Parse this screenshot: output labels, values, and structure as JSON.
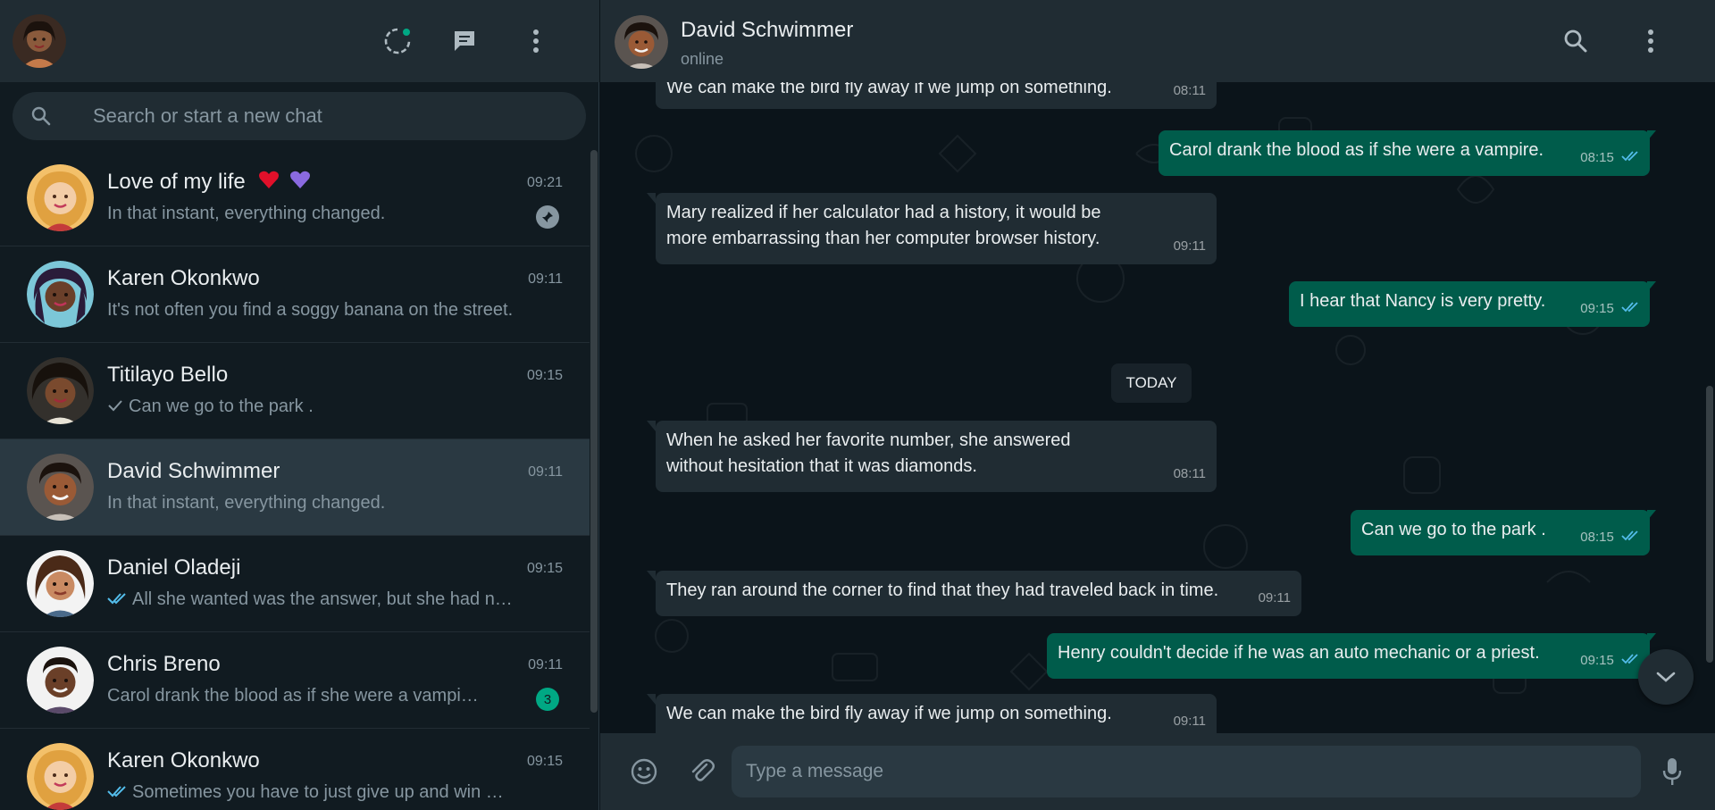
{
  "search": {
    "placeholder": "Search or start a new chat"
  },
  "chats": [
    {
      "name": "Love of my life",
      "time": "09:21",
      "preview": "In that instant, everything changed.",
      "pinned": true,
      "hearts": [
        "red-heart",
        "purple-heart"
      ]
    },
    {
      "name": "Karen Okonkwo",
      "time": "09:11",
      "preview": "It's not often you find a soggy banana on the street."
    },
    {
      "name": "Titilayo Bello",
      "time": "09:15",
      "preview": "Can we go to the park .",
      "tick": "single"
    },
    {
      "name": "David Schwimmer",
      "time": "09:11",
      "preview": "In that instant, everything changed.",
      "active": true
    },
    {
      "name": "Daniel Oladeji",
      "time": "09:15",
      "preview": "All she wanted was the answer, but she had n…",
      "tick": "double-blue"
    },
    {
      "name": "Chris Breno",
      "time": "09:11",
      "preview": "Carol drank the blood as if she were a vampi…",
      "unread": "3"
    },
    {
      "name": "Karen Okonkwo",
      "time": "09:15",
      "preview": "Sometimes you have to just give up and win …",
      "tick": "double-blue"
    }
  ],
  "conversation": {
    "name": "David Schwimmer",
    "status": "online",
    "date_label": "TODAY",
    "messages": [
      {
        "dir": "in",
        "text": "We can make the bird fly away if we jump on something.",
        "time": "08:11"
      },
      {
        "dir": "out",
        "text": "Carol drank the blood as if she were a vampire.",
        "time": "08:15"
      },
      {
        "dir": "in",
        "text": "Mary realized if her calculator had a history, it would be more embarrassing than her computer browser history.",
        "time": "09:11"
      },
      {
        "dir": "out",
        "text": "I hear that Nancy is very pretty.",
        "time": "09:15"
      },
      {
        "dir": "in",
        "text": "When he asked her favorite number, she answered without hesitation that it was diamonds.",
        "time": "08:11"
      },
      {
        "dir": "out",
        "text": "Can we go to the park .",
        "time": "08:15"
      },
      {
        "dir": "in",
        "text": "They ran around the corner to find that they had traveled back in time.",
        "time": "09:11"
      },
      {
        "dir": "out",
        "text": "Henry couldn't decide if he was an auto mechanic or a priest.",
        "time": "09:15"
      },
      {
        "dir": "in",
        "text": "We can make the bird fly away if we jump on something.",
        "time": "09:11"
      }
    ]
  },
  "composer": {
    "placeholder": "Type a message"
  },
  "colors": {
    "accent": "#00a884",
    "outgoing": "#005c4b",
    "incoming": "#202c33",
    "read_tick": "#53bdeb",
    "panel": "#202c33",
    "background": "#111b21"
  }
}
